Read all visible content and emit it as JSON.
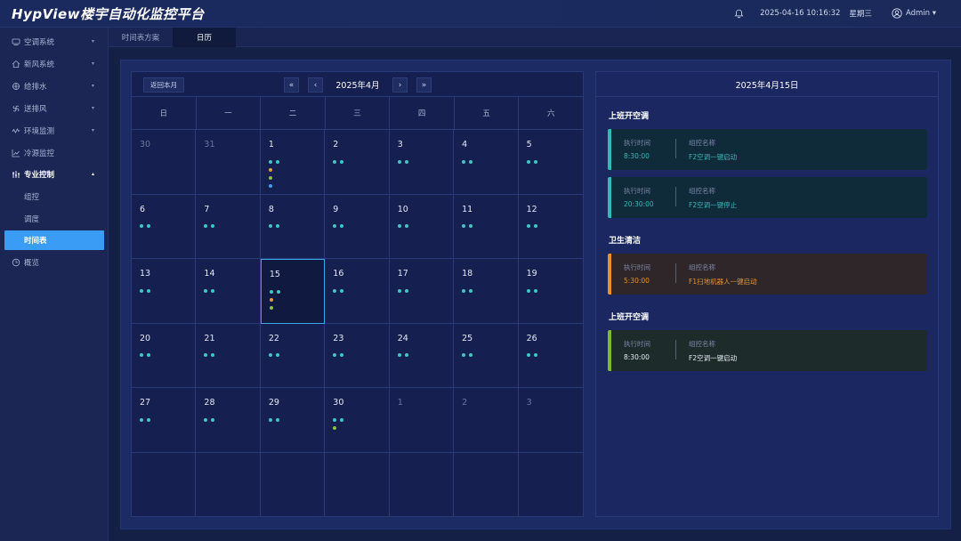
{
  "header": {
    "logo": "HypView楼宇自动化监控平台",
    "datetime": "2025-04-16 10:16:32",
    "weekday": "星期三",
    "user": "Admin ▾"
  },
  "sidebar": {
    "items": [
      {
        "label": "空调系统",
        "icon": "ac-icon"
      },
      {
        "label": "新风系统",
        "icon": "home-icon"
      },
      {
        "label": "给排水",
        "icon": "water-icon"
      },
      {
        "label": "送排风",
        "icon": "fan-icon"
      },
      {
        "label": "环境监测",
        "icon": "wave-icon"
      },
      {
        "label": "冷源监控",
        "icon": "chart-icon"
      },
      {
        "label": "专业控制",
        "icon": "control-icon"
      },
      {
        "label": "组控",
        "icon": ""
      },
      {
        "label": "调度",
        "icon": ""
      },
      {
        "label": "时间表",
        "icon": ""
      },
      {
        "label": "概览",
        "icon": "clock-icon"
      }
    ]
  },
  "tabs": [
    {
      "label": "时间表方案"
    },
    {
      "label": "日历"
    }
  ],
  "calendar": {
    "back_label": "返回本月",
    "nav": {
      "prev_year": "«",
      "prev_month": "‹",
      "next_month": "›",
      "next_year": "»"
    },
    "month_title": "2025年4月",
    "weekdays": [
      "日",
      "一",
      "二",
      "三",
      "四",
      "五",
      "六"
    ],
    "weeks": [
      [
        {
          "d": "30",
          "o": true,
          "dots": []
        },
        {
          "d": "31",
          "o": true,
          "dots": []
        },
        {
          "d": "1",
          "dots": [
            [
              "teal",
              "teal"
            ],
            [
              "orange"
            ],
            [
              "green"
            ],
            [
              "blue"
            ]
          ]
        },
        {
          "d": "2",
          "dots": [
            [
              "teal",
              "teal"
            ]
          ]
        },
        {
          "d": "3",
          "dots": [
            [
              "teal",
              "teal"
            ]
          ]
        },
        {
          "d": "4",
          "dots": [
            [
              "teal",
              "teal"
            ]
          ]
        },
        {
          "d": "5",
          "dots": [
            [
              "teal",
              "teal"
            ]
          ]
        }
      ],
      [
        {
          "d": "6",
          "dots": [
            [
              "teal",
              "teal"
            ]
          ]
        },
        {
          "d": "7",
          "dots": [
            [
              "teal",
              "teal"
            ]
          ]
        },
        {
          "d": "8",
          "dots": [
            [
              "teal",
              "teal"
            ]
          ]
        },
        {
          "d": "9",
          "dots": [
            [
              "teal",
              "teal"
            ]
          ]
        },
        {
          "d": "10",
          "dots": [
            [
              "teal",
              "teal"
            ]
          ]
        },
        {
          "d": "11",
          "dots": [
            [
              "teal",
              "teal"
            ]
          ]
        },
        {
          "d": "12",
          "dots": [
            [
              "teal",
              "teal"
            ]
          ]
        }
      ],
      [
        {
          "d": "13",
          "dots": [
            [
              "teal",
              "teal"
            ]
          ]
        },
        {
          "d": "14",
          "dots": [
            [
              "teal",
              "teal"
            ]
          ]
        },
        {
          "d": "15",
          "sel": true,
          "dots": [
            [
              "teal",
              "teal"
            ],
            [
              "orange"
            ],
            [
              "green"
            ]
          ]
        },
        {
          "d": "16",
          "dots": [
            [
              "teal",
              "teal"
            ]
          ]
        },
        {
          "d": "17",
          "dots": [
            [
              "teal",
              "teal"
            ]
          ]
        },
        {
          "d": "18",
          "dots": [
            [
              "teal",
              "teal"
            ]
          ]
        },
        {
          "d": "19",
          "dots": [
            [
              "teal",
              "teal"
            ]
          ]
        }
      ],
      [
        {
          "d": "20",
          "dots": [
            [
              "teal",
              "teal"
            ]
          ]
        },
        {
          "d": "21",
          "dots": [
            [
              "teal",
              "teal"
            ]
          ]
        },
        {
          "d": "22",
          "dots": [
            [
              "teal",
              "teal"
            ]
          ]
        },
        {
          "d": "23",
          "dots": [
            [
              "teal",
              "teal"
            ]
          ]
        },
        {
          "d": "24",
          "dots": [
            [
              "teal",
              "teal"
            ]
          ]
        },
        {
          "d": "25",
          "dots": [
            [
              "teal",
              "teal"
            ]
          ]
        },
        {
          "d": "26",
          "dots": [
            [
              "teal",
              "teal"
            ]
          ]
        }
      ],
      [
        {
          "d": "27",
          "dots": [
            [
              "teal",
              "teal"
            ]
          ]
        },
        {
          "d": "28",
          "dots": [
            [
              "teal",
              "teal"
            ]
          ]
        },
        {
          "d": "29",
          "dots": [
            [
              "teal",
              "teal"
            ]
          ]
        },
        {
          "d": "30",
          "dots": [
            [
              "teal",
              "teal"
            ],
            [
              "green"
            ]
          ]
        },
        {
          "d": "1",
          "o": true,
          "dots": []
        },
        {
          "d": "2",
          "o": true,
          "dots": []
        },
        {
          "d": "3",
          "o": true,
          "dots": []
        }
      ],
      [
        {
          "d": "",
          "o": true,
          "dots": []
        },
        {
          "d": "",
          "o": true,
          "dots": []
        },
        {
          "d": "",
          "o": true,
          "dots": []
        },
        {
          "d": "",
          "o": true,
          "dots": []
        },
        {
          "d": "",
          "o": true,
          "dots": []
        },
        {
          "d": "",
          "o": true,
          "dots": []
        },
        {
          "d": "",
          "o": true,
          "dots": []
        }
      ]
    ]
  },
  "detail": {
    "title": "2025年4月15日",
    "groups": [
      {
        "title": "上班开空调",
        "cards": [
          {
            "time_label": "执行时间",
            "name_label": "组控名称",
            "time": "8:30:00",
            "name": "F2空调一键启动",
            "color": "#34b8b8",
            "bg": "#0f2a38"
          },
          {
            "time_label": "执行时间",
            "name_label": "组控名称",
            "time": "20:30:00",
            "name": "F2空调一键停止",
            "color": "#34b8b8",
            "bg": "#0f2a38"
          }
        ]
      },
      {
        "title": "卫生清洁",
        "cards": [
          {
            "time_label": "执行时间",
            "name_label": "组控名称",
            "time": "5:30:00",
            "name": "F1扫地机器人一键启动",
            "color": "#e5922f",
            "bg": "#2e2628"
          }
        ]
      },
      {
        "title": "上班开空调",
        "cards": [
          {
            "time_label": "执行时间",
            "name_label": "组控名称",
            "time": "8:30:00",
            "name": "F2空调一键启动",
            "color": "#7fba2e",
            "bg": "#1d2b2b",
            "textcolor": "#e6ebf5"
          }
        ]
      }
    ]
  },
  "colors": {
    "accent": "#3a9cf4",
    "teal": "#3fc6c6",
    "orange": "#e59a45",
    "green": "#8fc03a",
    "blue": "#3fa0e8"
  }
}
